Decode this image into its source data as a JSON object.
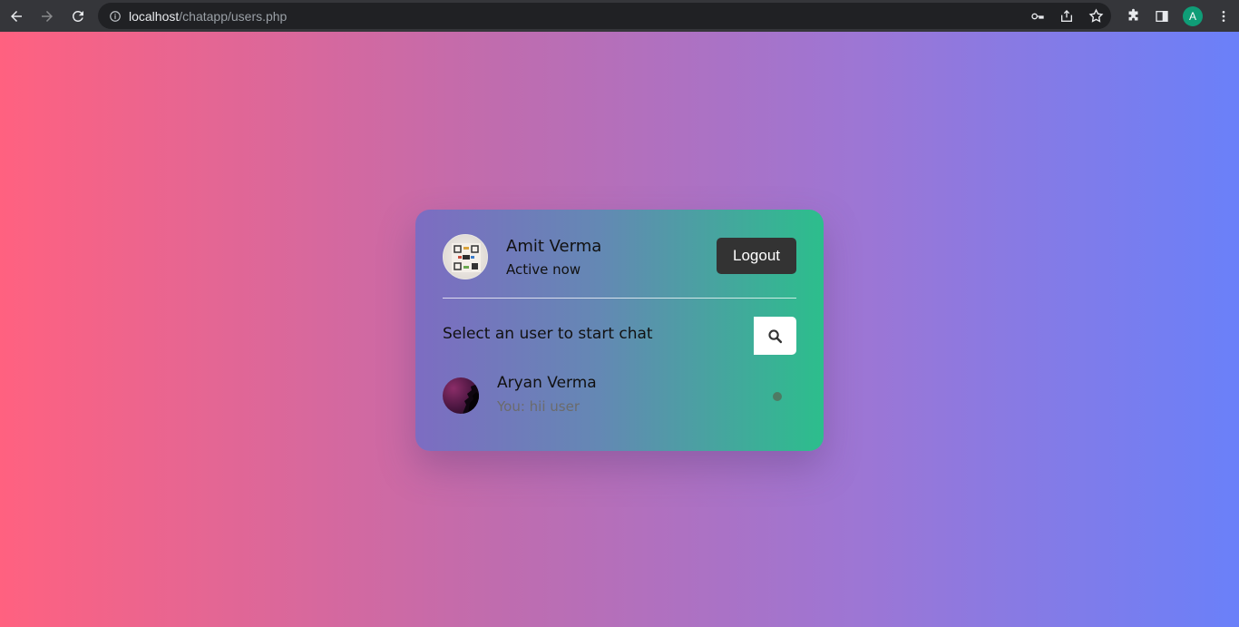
{
  "browser": {
    "url_host": "localhost",
    "url_path": "/chatapp/users.php",
    "profile_initial": "A"
  },
  "header": {
    "user_name": "Amit Verma",
    "status": "Active now",
    "logout_label": "Logout"
  },
  "search": {
    "text": "Select an user to start chat"
  },
  "users": [
    {
      "name": "Aryan Verma",
      "last_message": "You: hii user",
      "online_status_color": "#4e7a63"
    }
  ],
  "colors": {
    "bg_gradient": [
      "#ff6180",
      "#6a80f9"
    ],
    "card_gradient": [
      "#7d6cc2",
      "#2cbe8c"
    ],
    "logout_bg": "#333333"
  }
}
